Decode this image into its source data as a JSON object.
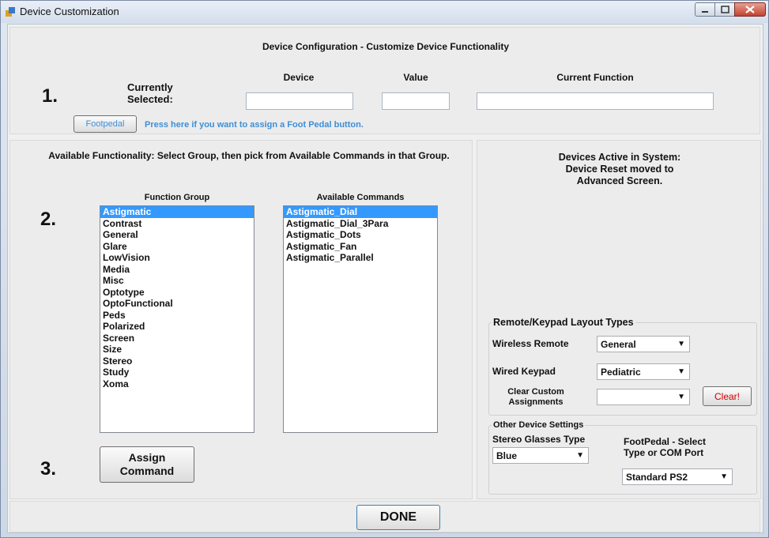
{
  "window": {
    "title": "Device Customization"
  },
  "section1": {
    "heading": "Device Configuration - Customize Device Functionality",
    "step": "1.",
    "currently_selected": "Currently\nSelected:",
    "col_device": "Device",
    "col_value": "Value",
    "col_current_function": "Current Function",
    "device_value": "",
    "value_value": "",
    "current_function_value": "",
    "footpedal_button": "Footpedal",
    "footpedal_hint": "Press here if you want to assign a Foot Pedal button."
  },
  "section2": {
    "heading": "Available Functionality: Select Group, then pick from Available Commands in that Group.",
    "step": "2.",
    "function_group_label": "Function Group",
    "available_commands_label": "Available Commands",
    "function_groups": [
      "Astigmatic",
      "Contrast",
      "General",
      "Glare",
      "LowVision",
      "Media",
      "Misc",
      "Optotype",
      "OptoFunctional",
      "Peds",
      "Polarized",
      "Screen",
      "Size",
      "Stereo",
      "Study",
      "Xoma"
    ],
    "selected_function_group": "Astigmatic",
    "available_commands": [
      "Astigmatic_Dial",
      "Astigmatic_Dial_3Para",
      "Astigmatic_Dots",
      "Astigmatic_Fan",
      "Astigmatic_Parallel"
    ],
    "selected_command": "Astigmatic_Dial"
  },
  "section3": {
    "step": "3.",
    "assign_button": "Assign\nCommand"
  },
  "right_panel": {
    "devices_active": "Devices Active in System:\nDevice Reset moved to\nAdvanced Screen.",
    "layout_types": {
      "title": "Remote/Keypad Layout Types",
      "wireless_remote_label": "Wireless Remote",
      "wireless_remote_value": "General",
      "wired_keypad_label": "Wired Keypad",
      "wired_keypad_value": "Pediatric",
      "clear_custom_label": "Clear Custom\nAssignments",
      "clear_custom_value": "",
      "clear_button": "Clear!",
      "clear_button_color": "#cc0000"
    },
    "other_settings": {
      "title": "Other Device Settings",
      "stereo_label": "Stereo Glasses Type",
      "stereo_value": "Blue",
      "footpedal_label": "FootPedal - Select\nType or COM Port",
      "footpedal_value": "Standard PS2"
    }
  },
  "done_button": "DONE",
  "colors": {
    "hint_blue": "#3d8fd6",
    "selection": "#3399ff"
  }
}
